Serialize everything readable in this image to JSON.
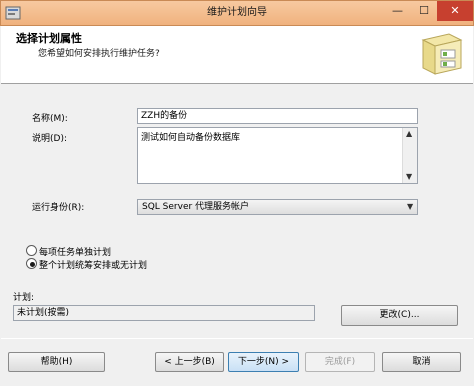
{
  "window": {
    "title": "维护计划向导",
    "min_glyph": "—",
    "max_glyph": "☐",
    "close_glyph": "✕"
  },
  "header": {
    "title": "选择计划属性",
    "subtitle": "您希望如何安排执行维护任务?"
  },
  "form": {
    "name_label": "名称(M):",
    "name_value": "ZZH的备份",
    "desc_label": "说明(D):",
    "desc_value": "测试如何自动备份数据库",
    "runas_label": "运行身份(R):",
    "runas_value": "SQL Server 代理服务帐户",
    "radio_separate": "每项任务单独计划",
    "radio_single": "整个计划统筹安排或无计划",
    "radio_selected": "single",
    "schedule_label": "计划:",
    "schedule_value": "未计划(按需)",
    "change_button": "更改(C)..."
  },
  "footer": {
    "help": "帮助(H)",
    "back": "< 上一步(B)",
    "next": "下一步(N) >",
    "finish": "完成(F)",
    "cancel": "取消"
  },
  "icons": {
    "app": "maintenance-wizard-icon",
    "header_art": "wizard-folder-icon"
  }
}
